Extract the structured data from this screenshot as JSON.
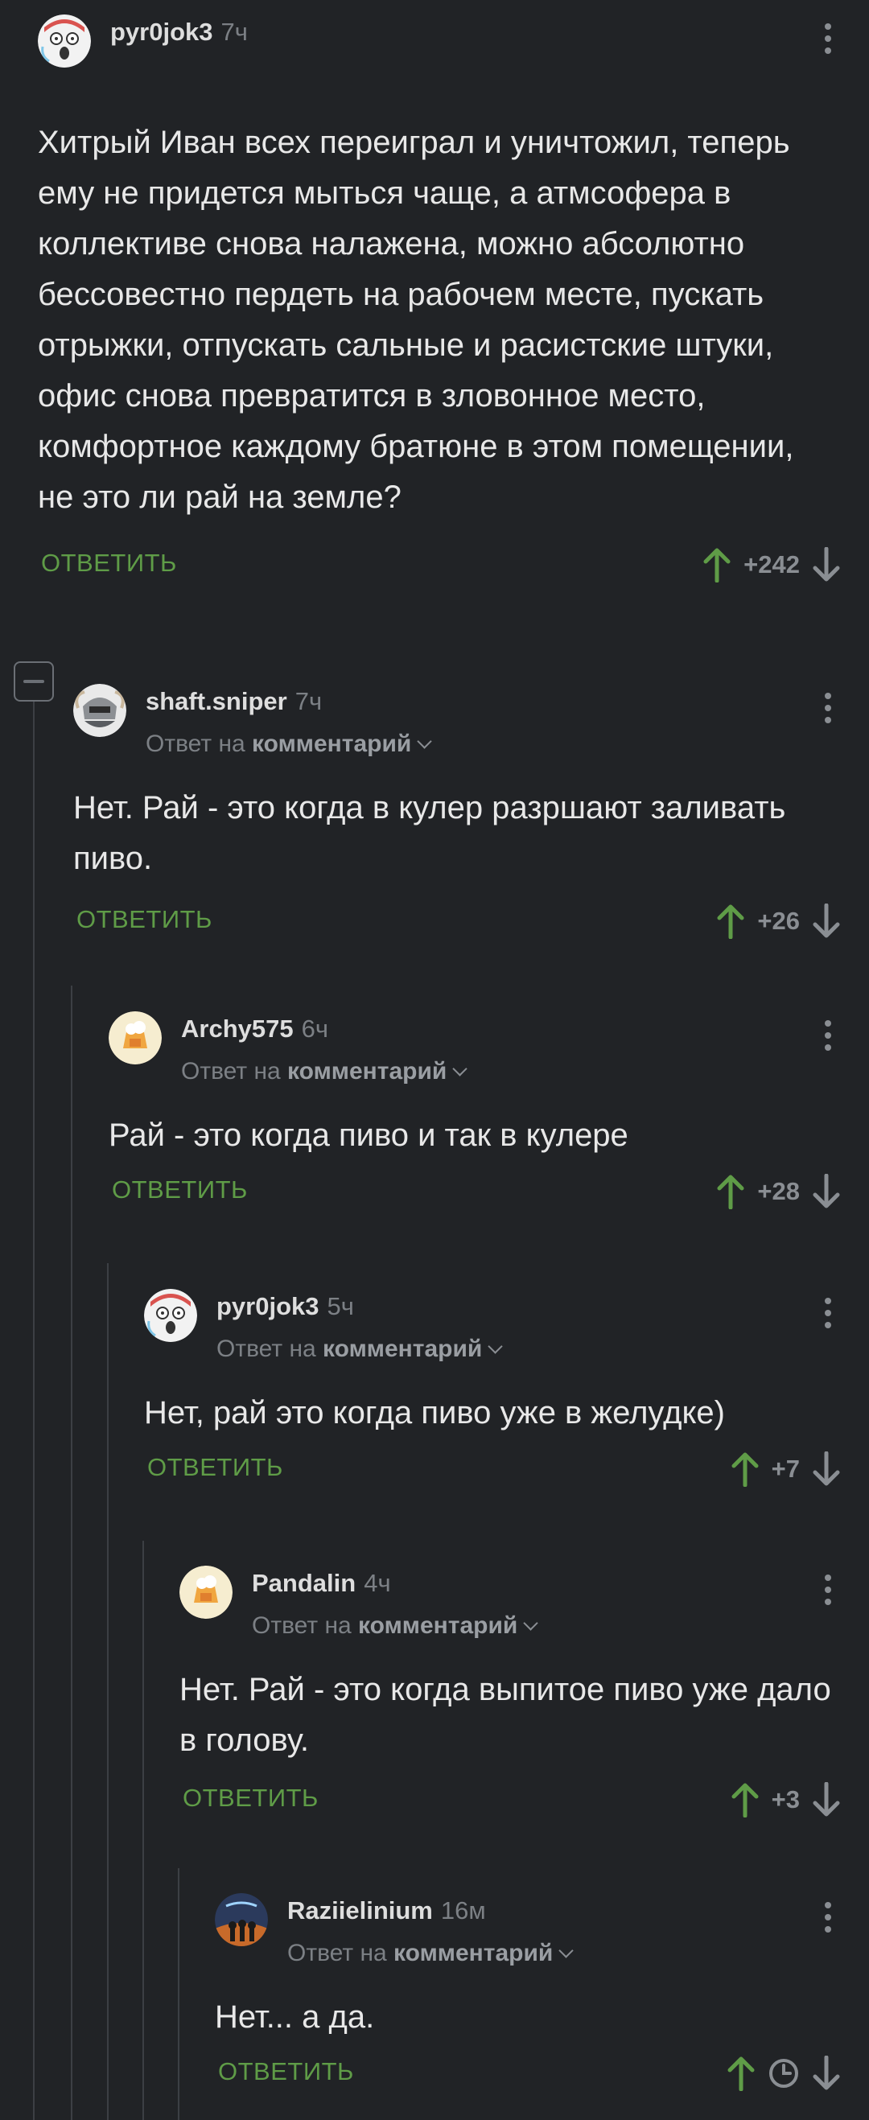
{
  "reply_label": "ОТВЕТИТЬ",
  "reply_to_prefix": "Ответ на",
  "reply_to_target": "комментарий",
  "comments": [
    {
      "author": "pyr0jok3",
      "time": "7ч",
      "text": "Хитрый Иван всех переиграл и уничтожил, теперь ему не придется мыться чаще, а атмсофера в коллективе снова налажена, можно абсолютно бессовестно пердеть на рабочем месте, пускать отрыжки, отпускать сальные и расистские штуки, офис снова превратится в зловонное место, комфортное каждому братюне в этом помещении, не это ли рай на земле?",
      "score": "+242"
    },
    {
      "author": "shaft.sniper",
      "time": "7ч",
      "text": "Нет. Рай - это когда в кулер разршают заливать пиво.",
      "score": "+26"
    },
    {
      "author": "Archy575",
      "time": "6ч",
      "text": "Рай - это когда пиво и так в кулере",
      "score": "+28"
    },
    {
      "author": "pyr0jok3",
      "time": "5ч",
      "text": "Нет, рай это когда пиво уже в желудке)",
      "score": "+7"
    },
    {
      "author": "Pandalin",
      "time": "4ч",
      "text": "Нет. Рай - это когда выпитое пиво уже дало в голову.",
      "score": "+3"
    },
    {
      "author": "Raziielinium",
      "time": "16м",
      "text": "Нет... а да.",
      "score": ""
    }
  ],
  "colors": {
    "background": "#212326",
    "reply_green": "#5f9c47",
    "upvote_green": "#5f9c47",
    "muted": "#8a8e93"
  },
  "icons": [
    "more-vertical-icon",
    "upvote-arrow-icon",
    "downvote-arrow-icon",
    "chevron-down-icon",
    "clock-icon",
    "collapse-minus-icon"
  ]
}
